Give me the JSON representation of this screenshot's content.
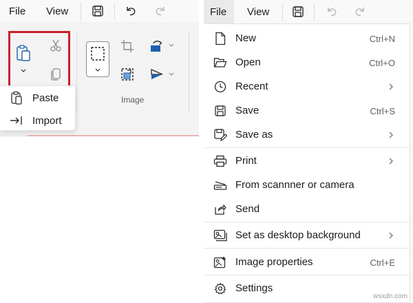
{
  "left": {
    "menubar": {
      "file": "File",
      "view": "View"
    },
    "ribbon": {
      "image_group_label": "Image"
    },
    "paste_popup": {
      "items": [
        "Paste",
        "Import"
      ]
    }
  },
  "right": {
    "menubar": {
      "file": "File",
      "view": "View"
    },
    "file_menu": {
      "items": [
        {
          "label": "New",
          "shortcut": "Ctrl+N",
          "icon": "new-file-icon"
        },
        {
          "label": "Open",
          "shortcut": "Ctrl+O",
          "icon": "folder-open-icon"
        },
        {
          "label": "Recent",
          "submenu": true,
          "icon": "clock-icon"
        },
        {
          "label": "Save",
          "shortcut": "Ctrl+S",
          "icon": "save-icon"
        },
        {
          "label": "Save as",
          "submenu": true,
          "icon": "save-as-icon"
        },
        {
          "label": "Print",
          "submenu": true,
          "icon": "printer-icon"
        },
        {
          "label": "From scannner or camera",
          "icon": "scanner-icon"
        },
        {
          "label": "Send",
          "icon": "share-icon"
        },
        {
          "label": "Set as desktop background",
          "submenu": true,
          "icon": "desktop-background-icon"
        },
        {
          "label": "Image properties",
          "shortcut": "Ctrl+E",
          "icon": "image-properties-icon"
        },
        {
          "label": "Settings",
          "icon": "settings-gear-icon"
        }
      ]
    }
  },
  "watermark": "wsxdn.com",
  "colors": {
    "highlight_box": "#c8202d",
    "accent_blue": "#1f5fae",
    "icon_gray": "#2b2b2b"
  }
}
